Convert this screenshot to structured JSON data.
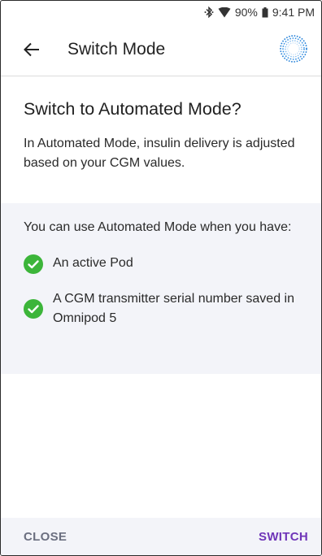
{
  "status_bar": {
    "battery": "90%",
    "time": "9:41 PM",
    "icons": [
      "bluetooth-icon",
      "wifi-icon",
      "battery-icon"
    ]
  },
  "app_bar": {
    "title": "Switch Mode",
    "back_icon": "arrow-left-icon",
    "logo_icon": "omnipod-ring-logo"
  },
  "content": {
    "heading": "Switch to Automated Mode?",
    "intro": "In Automated Mode, insulin delivery is adjusted based on your CGM values.",
    "requirements_title": "You can use Automated Mode when you have:",
    "requirements": [
      {
        "text": "An active Pod",
        "icon": "check-circle-icon"
      },
      {
        "text": "A CGM transmitter serial number saved in Omnipod 5",
        "icon": "check-circle-icon"
      }
    ]
  },
  "footer": {
    "close_label": "CLOSE",
    "switch_label": "SWITCH"
  },
  "colors": {
    "accent": "#6f35b8",
    "check_green": "#3cb53a",
    "panel_bg": "#f3f4f9",
    "secondary_text": "#6b6f80"
  }
}
